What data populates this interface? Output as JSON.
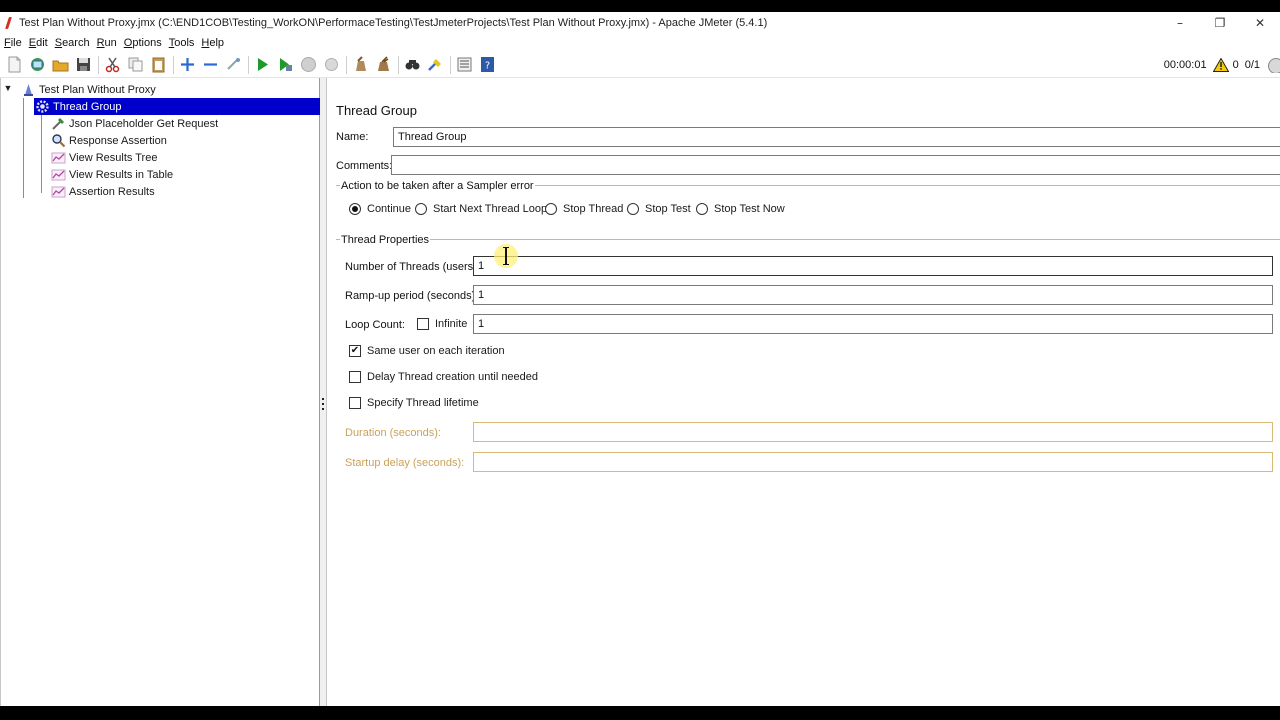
{
  "window": {
    "title": "Test Plan Without Proxy.jmx (C:\\END1COB\\Testing_WorkON\\PerformaceTesting\\TestJmeterProjects\\Test Plan Without Proxy.jmx) - Apache JMeter (5.4.1)",
    "controls": {
      "minimize": "–",
      "restore": "❐",
      "close": "✕"
    }
  },
  "menu": [
    {
      "underline": "F",
      "rest": "ile"
    },
    {
      "underline": "E",
      "rest": "dit"
    },
    {
      "underline": "S",
      "rest": "earch"
    },
    {
      "underline": "R",
      "rest": "un"
    },
    {
      "underline": "O",
      "rest": "ptions"
    },
    {
      "underline": "T",
      "rest": "ools"
    },
    {
      "underline": "H",
      "rest": "elp"
    }
  ],
  "toolbar_status": {
    "elapsed": "00:00:01",
    "warnings": "0",
    "threads": "0/1"
  },
  "tree": {
    "root": "Test Plan Without Proxy",
    "selected": "Thread Group",
    "children": [
      "Json Placeholder Get Request",
      "Response Assertion",
      "View Results Tree",
      "View Results in Table",
      "Assertion Results"
    ]
  },
  "form": {
    "title": "Thread Group",
    "name_label": "Name:",
    "name_value": "Thread Group",
    "comments_label": "Comments:",
    "comments_value": "",
    "action_group_title": "Action to be taken after a Sampler error",
    "actions": [
      {
        "label": "Continue",
        "selected": true
      },
      {
        "label": "Start Next Thread Loop",
        "selected": false
      },
      {
        "label": "Stop Thread",
        "selected": false
      },
      {
        "label": "Stop Test",
        "selected": false
      },
      {
        "label": "Stop Test Now",
        "selected": false
      }
    ],
    "thread_props_title": "Thread Properties",
    "threads_label": "Number of Threads (users):",
    "threads_value": "1",
    "rampup_label": "Ramp-up period (seconds):",
    "rampup_value": "1",
    "loop_label": "Loop Count:",
    "infinite_label": "Infinite",
    "loop_value": "1",
    "same_user_label": "Same user on each iteration",
    "delay_label": "Delay Thread creation until needed",
    "lifetime_label": "Specify Thread lifetime",
    "duration_label": "Duration (seconds):",
    "duration_value": "",
    "startup_label": "Startup delay (seconds):",
    "startup_value": "",
    "checks": {
      "check_mark": "✔"
    }
  }
}
